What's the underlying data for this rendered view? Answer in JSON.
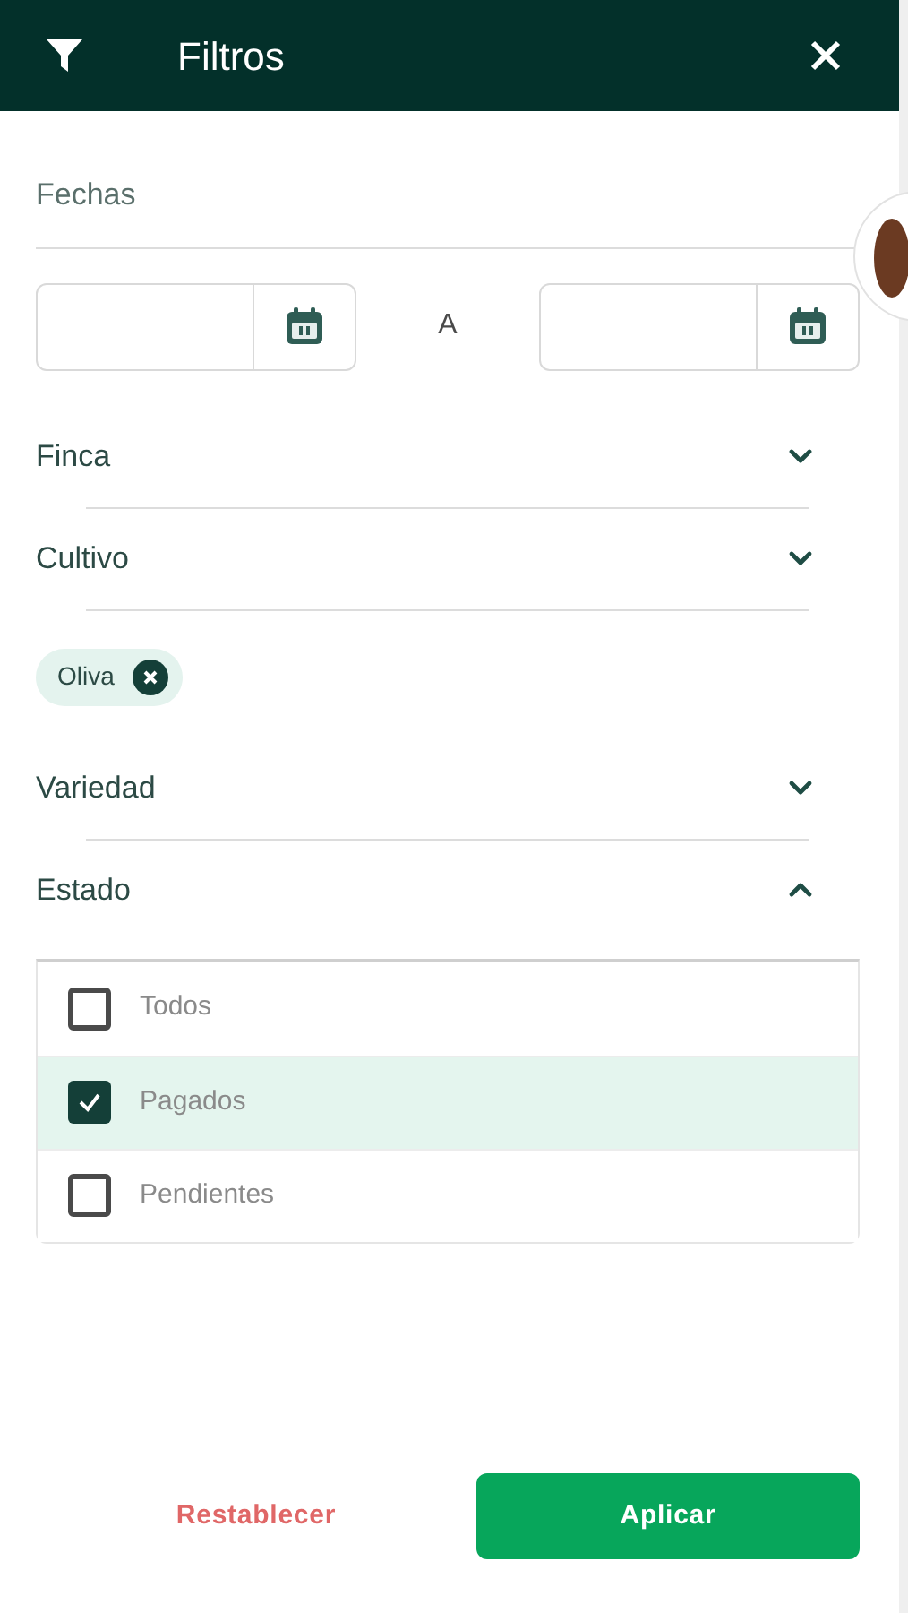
{
  "header": {
    "title": "Filtros"
  },
  "dates": {
    "label": "Fechas",
    "separator": "A"
  },
  "sections": [
    {
      "label": "Finca",
      "expanded": false
    },
    {
      "label": "Cultivo",
      "expanded": false,
      "chips": [
        "Oliva"
      ]
    },
    {
      "label": "Variedad",
      "expanded": false
    },
    {
      "label": "Estado",
      "expanded": true,
      "options": [
        {
          "label": "Todos",
          "checked": false
        },
        {
          "label": "Pagados",
          "checked": true
        },
        {
          "label": "Pendientes",
          "checked": false
        }
      ]
    }
  ],
  "footer": {
    "reset": "Restablecer",
    "apply": "Aplicar"
  }
}
